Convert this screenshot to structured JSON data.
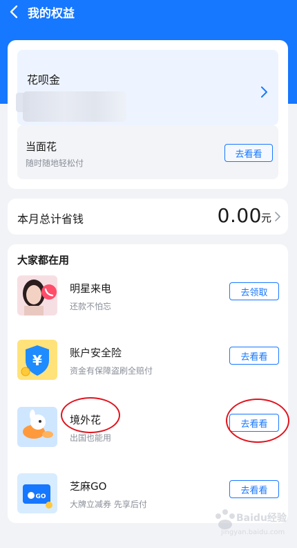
{
  "header": {
    "title": "我的权益",
    "back_icon": "chevron-left-icon",
    "bg_color": "#1677ff"
  },
  "huabei": {
    "title": "花呗金"
  },
  "dangmian": {
    "title": "当面花",
    "subtitle": "随时随地轻松付",
    "button": "去看看"
  },
  "savings": {
    "label": "本月总计省钱",
    "amount": "0.00",
    "unit": "元"
  },
  "section": {
    "title": "大家都在用",
    "items": [
      {
        "title": "明星来电",
        "subtitle": "还款不怕忘",
        "button": "去领取",
        "icon": "celebrity-call-icon"
      },
      {
        "title": "账户安全险",
        "subtitle": "资金有保障盗刷全赔付",
        "button": "去看看",
        "icon": "shield-yen-icon"
      },
      {
        "title": "境外花",
        "subtitle": "出国也能用",
        "button": "去看看",
        "icon": "overseas-mascot-icon"
      },
      {
        "title": "芝麻GO",
        "subtitle": "大牌立减券 先享后付",
        "button": "去看看",
        "icon": "sesame-go-card-icon"
      }
    ]
  },
  "watermark": {
    "text": "Baidu经验",
    "subtext": "jingyan.baidu.com"
  },
  "colors": {
    "accent": "#1677ff",
    "annotation": "#e0141e"
  }
}
